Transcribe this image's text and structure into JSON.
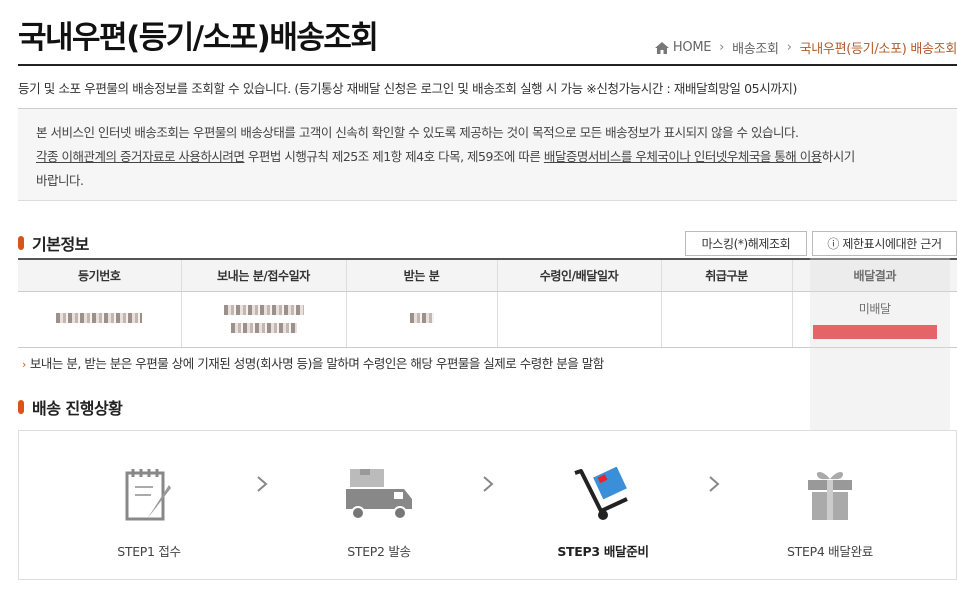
{
  "header": {
    "title": "국내우편(등기/소포)배송조회",
    "breadcrumb": [
      "HOME",
      "배송조회",
      "국내우편(등기/소포) 배송조회"
    ]
  },
  "intro": "등기 및 소포 우편물의 배송정보를 조회할 수 있습니다. (등기통상 재배달 신청은 로그인 및 배송조회 실행 시 가능 ※신청가능시간 : 재배달희망일 05시까지)",
  "notice": {
    "line1": "본 서비스인 인터넷 배송조회는 우편물의 배송상태를 고객이 신속히 확인할 수 있도록 제공하는 것이 목적으로 모든 배송정보가 표시되지 않을 수 있습니다.",
    "line2_link1": "각종 이해관계의 증거자료로 사용하시려면",
    "line2_mid": " 우편법 시행규칙 제25조 제1항 제4호 다목, 제59조에 따른 ",
    "line2_link2": "배달증명서비스를 우체국이나 인터넷우체국을 통해 이용",
    "line2_end": "하시기",
    "line3": "바랍니다."
  },
  "basic_info": {
    "section_title": "기본정보",
    "unmask_button": "마스킹(*)해제조회",
    "restriction_button": "ⓘ 제한표시에대한 근거",
    "columns": [
      "등기번호",
      "보내는 분/접수일자",
      "받는 분",
      "수령인/배달일자",
      "취급구분",
      "배달결과"
    ],
    "row": {
      "result": "미배달"
    }
  },
  "footnote": "보내는 분, 받는 분은 우편물 상에 기재된 성명(회사명 등)을 말하며 수령인은 해당 우편물을 실제로 수령한 분을 말함",
  "progress": {
    "section_title": "배송 진행상황",
    "steps": [
      {
        "label": "STEP1 접수",
        "icon": "clipboard-icon",
        "active": false
      },
      {
        "label": "STEP2 발송",
        "icon": "truck-icon",
        "active": false
      },
      {
        "label": "STEP3 배달준비",
        "icon": "hand-cart-icon",
        "active": true
      },
      {
        "label": "STEP4 배달완료",
        "icon": "gift-box-icon",
        "active": false
      }
    ]
  },
  "colors": {
    "accent": "#d9541a",
    "breadcrumb_current": "#b25b2a",
    "active_step": "#1e78c8",
    "alert_bar": "#e8242a"
  }
}
